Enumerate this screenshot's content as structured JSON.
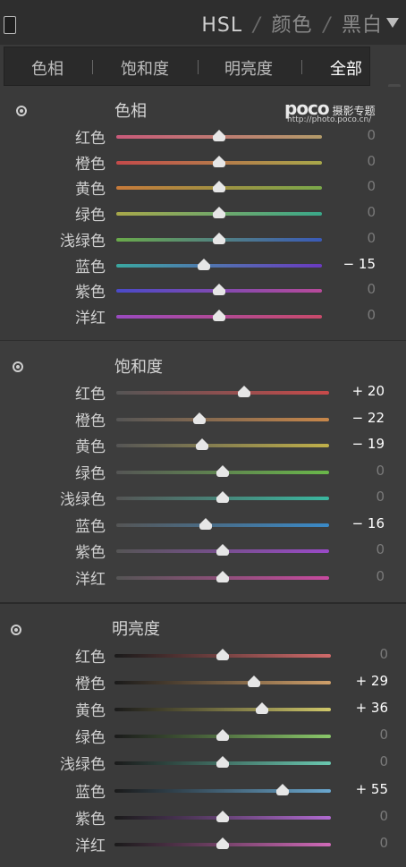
{
  "header": {
    "grip_icon": "panel-grip-icon",
    "items": [
      "HSL",
      "颜色",
      "黑白"
    ],
    "separator": "/",
    "menu_icon": "triangle-down-icon"
  },
  "tabs": [
    {
      "label": "色相",
      "active": false
    },
    {
      "label": "饱和度",
      "active": false
    },
    {
      "label": "明亮度",
      "active": false
    },
    {
      "label": "全部",
      "active": true
    }
  ],
  "watermark": {
    "logo": "poco",
    "text": "摄影专题",
    "url": "http://photo.poco.cn/"
  },
  "sections": [
    {
      "key": "hue",
      "title": "色相",
      "icon": "target-adjust-icon",
      "rows": [
        {
          "label": "红色",
          "value": "0",
          "num": 0,
          "colors": [
            "#c95a7a",
            "#b39b6a"
          ]
        },
        {
          "label": "橙色",
          "value": "0",
          "num": 0,
          "colors": [
            "#c44a4a",
            "#a8a84a"
          ]
        },
        {
          "label": "黄色",
          "value": "0",
          "num": 0,
          "colors": [
            "#c77a3a",
            "#7aa84a"
          ]
        },
        {
          "label": "绿色",
          "value": "0",
          "num": 0,
          "colors": [
            "#a8a84a",
            "#3aa88a"
          ]
        },
        {
          "label": "浅绿色",
          "value": "0",
          "num": 0,
          "colors": [
            "#6aaa4a",
            "#3a5ab8"
          ]
        },
        {
          "label": "蓝色",
          "value": "− 15",
          "num": -15,
          "colors": [
            "#3aa8a0",
            "#6a3ac0"
          ]
        },
        {
          "label": "紫色",
          "value": "0",
          "num": 0,
          "colors": [
            "#4a4ac8",
            "#b84a9a"
          ]
        },
        {
          "label": "洋红",
          "value": "0",
          "num": 0,
          "colors": [
            "#9a4ac0",
            "#c84a6a"
          ]
        }
      ]
    },
    {
      "key": "saturation",
      "title": "饱和度",
      "icon": "target-adjust-icon",
      "rows": [
        {
          "label": "红色",
          "value": "+ 20",
          "num": 20,
          "colors": [
            "#555555",
            "#c84a4a"
          ]
        },
        {
          "label": "橙色",
          "value": "− 22",
          "num": -22,
          "colors": [
            "#555555",
            "#c8874a"
          ]
        },
        {
          "label": "黄色",
          "value": "− 19",
          "num": -19,
          "colors": [
            "#555555",
            "#c0b04a"
          ]
        },
        {
          "label": "绿色",
          "value": "0",
          "num": 0,
          "colors": [
            "#555555",
            "#6ab84a"
          ]
        },
        {
          "label": "浅绿色",
          "value": "0",
          "num": 0,
          "colors": [
            "#555555",
            "#3ab8a0"
          ]
        },
        {
          "label": "蓝色",
          "value": "− 16",
          "num": -16,
          "colors": [
            "#555555",
            "#3a8ac8"
          ]
        },
        {
          "label": "紫色",
          "value": "0",
          "num": 0,
          "colors": [
            "#555555",
            "#9a4ac8"
          ]
        },
        {
          "label": "洋红",
          "value": "0",
          "num": 0,
          "colors": [
            "#555555",
            "#c84aa0"
          ]
        }
      ]
    },
    {
      "key": "luminance",
      "title": "明亮度",
      "icon": "target-adjust-icon",
      "rows": [
        {
          "label": "红色",
          "value": "0",
          "num": 0,
          "colors": [
            "#1a1a1a",
            "#d06a6a"
          ]
        },
        {
          "label": "橙色",
          "value": "+ 29",
          "num": 29,
          "colors": [
            "#1a1a1a",
            "#d0a06a"
          ]
        },
        {
          "label": "黄色",
          "value": "+ 36",
          "num": 36,
          "colors": [
            "#1a1a1a",
            "#d0c86a"
          ]
        },
        {
          "label": "绿色",
          "value": "0",
          "num": 0,
          "colors": [
            "#1a1a1a",
            "#8ac86a"
          ]
        },
        {
          "label": "浅绿色",
          "value": "0",
          "num": 0,
          "colors": [
            "#1a1a1a",
            "#6ac8b0"
          ]
        },
        {
          "label": "蓝色",
          "value": "+ 55",
          "num": 55,
          "colors": [
            "#1a1a1a",
            "#6aa8d0"
          ]
        },
        {
          "label": "紫色",
          "value": "0",
          "num": 0,
          "colors": [
            "#1a1a1a",
            "#b06ad0"
          ]
        },
        {
          "label": "洋红",
          "value": "0",
          "num": 0,
          "colors": [
            "#1a1a1a",
            "#d06ab8"
          ]
        }
      ]
    }
  ]
}
